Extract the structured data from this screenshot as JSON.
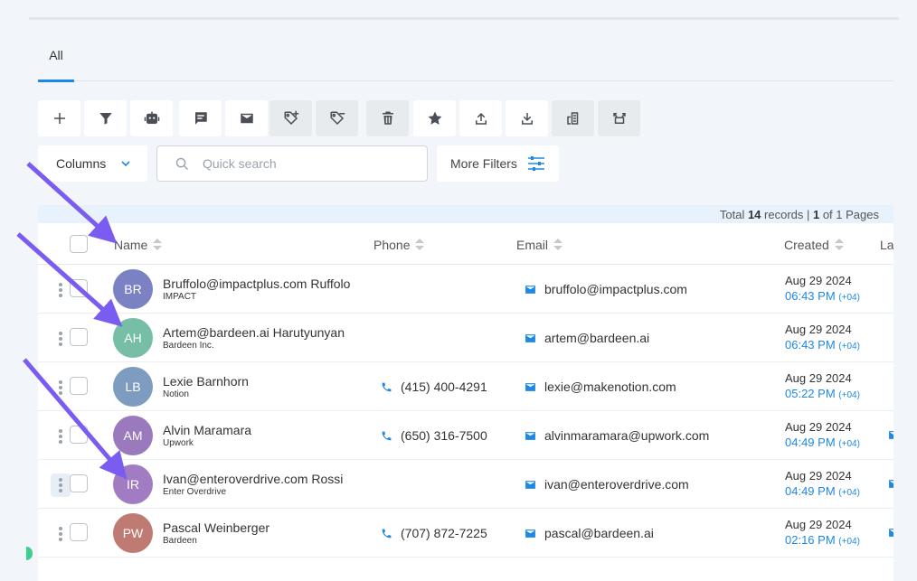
{
  "tabs": [
    {
      "label": "All",
      "active": true
    }
  ],
  "toolbar": {
    "buttons": [
      {
        "name": "add",
        "icon": "plus-icon"
      },
      {
        "name": "filter",
        "icon": "funnel-icon"
      },
      {
        "name": "automation",
        "icon": "robot-icon"
      },
      {
        "name": "sms",
        "icon": "chat-icon"
      },
      {
        "name": "email",
        "icon": "envelope-icon"
      },
      {
        "name": "add-tag",
        "icon": "tag-plus-icon"
      },
      {
        "name": "remove-tag",
        "icon": "tag-minus-icon"
      },
      {
        "name": "delete",
        "icon": "trash-icon"
      },
      {
        "name": "favorite",
        "icon": "star-icon"
      },
      {
        "name": "export",
        "icon": "upload-icon"
      },
      {
        "name": "import",
        "icon": "download-icon"
      },
      {
        "name": "company",
        "icon": "building-icon"
      },
      {
        "name": "merge",
        "icon": "merge-icon"
      }
    ]
  },
  "filters": {
    "columns_label": "Columns",
    "search_placeholder": "Quick search",
    "more_filters_label": "More Filters"
  },
  "summary": {
    "prefix": "Total ",
    "total": "14",
    "mid": " records | ",
    "page": "1",
    "suffix": " of 1 Pages"
  },
  "table": {
    "headers": {
      "name": "Name",
      "phone": "Phone",
      "email": "Email",
      "created": "Created",
      "last": "La"
    },
    "rows": [
      {
        "initials": "BR",
        "avatar_color": "#7b82c4",
        "name": "Bruffolo@impactplus.com Ruffolo",
        "company": "IMPACT",
        "phone": "",
        "email": "bruffolo@impactplus.com",
        "date": "Aug 29 2024",
        "time": "06:43 PM",
        "tz": "(+04)",
        "trail": false,
        "kebab_highlight": false
      },
      {
        "initials": "AH",
        "avatar_color": "#76bfa6",
        "name": "Artem@bardeen.ai Harutyunyan",
        "company": "Bardeen Inc.",
        "phone": "",
        "email": "artem@bardeen.ai",
        "date": "Aug 29 2024",
        "time": "06:43 PM",
        "tz": "(+04)",
        "trail": false,
        "kebab_highlight": false
      },
      {
        "initials": "LB",
        "avatar_color": "#7d9cc0",
        "name": "Lexie Barnhorn",
        "company": "Notion",
        "phone": "(415) 400-4291",
        "email": "lexie@makenotion.com",
        "date": "Aug 29 2024",
        "time": "05:22 PM",
        "tz": "(+04)",
        "trail": false,
        "kebab_highlight": false
      },
      {
        "initials": "AM",
        "avatar_color": "#9a79bd",
        "name": "Alvin Maramara",
        "company": "Upwork",
        "phone": "(650) 316-7500",
        "email": "alvinmaramara@upwork.com",
        "date": "Aug 29 2024",
        "time": "04:49 PM",
        "tz": "(+04)",
        "trail": true,
        "kebab_highlight": false
      },
      {
        "initials": "IR",
        "avatar_color": "#a27cc3",
        "name": "Ivan@enteroverdrive.com Rossi",
        "company": "Enter Overdrive",
        "phone": "",
        "email": "ivan@enteroverdrive.com",
        "date": "Aug 29 2024",
        "time": "04:49 PM",
        "tz": "(+04)",
        "trail": true,
        "kebab_highlight": true
      },
      {
        "initials": "PW",
        "avatar_color": "#c07a74",
        "name": "Pascal Weinberger",
        "company": "Bardeen",
        "phone": "(707) 872-7225",
        "email": "pascal@bardeen.ai",
        "date": "Aug 29 2024",
        "time": "02:16 PM",
        "tz": "(+04)",
        "trail": true,
        "kebab_highlight": false
      }
    ]
  },
  "colors": {
    "accent": "#1e88e5",
    "annotation_arrow": "#7b5cf0",
    "background": "#f2f6fa"
  }
}
